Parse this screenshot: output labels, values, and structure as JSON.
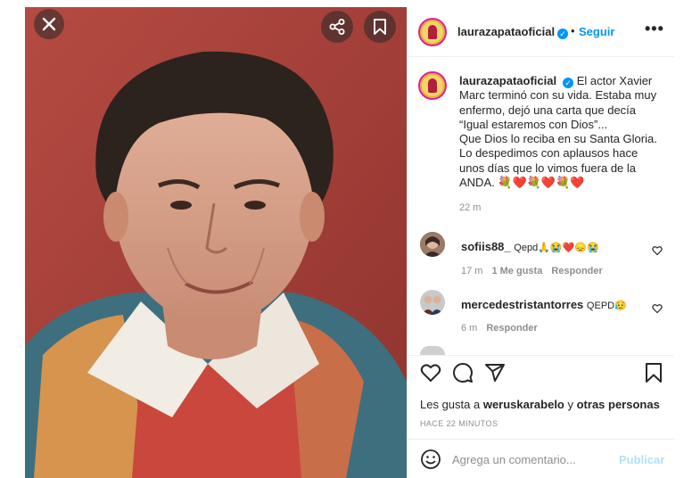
{
  "post": {
    "username": "laurazapataoficial",
    "follow_label": "Seguir",
    "separator": "•",
    "more_label": "•••",
    "verified_glyph": "✓",
    "caption_lines": [
      "El actor Xavier",
      "Marc terminó con su vida. Estaba muy",
      "enfermo, dejó una carta que decía",
      "“Igual estaremos con Dios”...",
      "Que Dios lo reciba en su Santa Gloria.",
      "Lo despedimos con aplausos hace",
      "unos días que lo vimos fuera de la",
      "ANDA. 💐❤️💐❤️💐❤️"
    ],
    "caption_time": "22 m"
  },
  "comments": [
    {
      "username": "sofiis88_",
      "text": "Qepd🙏😭❤️😞😭",
      "time": "17 m",
      "likes": "1 Me gusta",
      "reply": "Responder"
    },
    {
      "username": "mercedestristantorres",
      "text": "QEPD😥",
      "time": "6 m",
      "reply": "Responder"
    }
  ],
  "footer": {
    "likes_prefix": "Les gusta a ",
    "likes_user": "weruskarabelo",
    "likes_middle": " y ",
    "likes_others": "otras personas",
    "post_time": "HACE 22 MINUTOS",
    "comment_placeholder": "Agrega un comentario...",
    "publish_label": "Publicar"
  },
  "icons": {
    "close": "close-icon",
    "share": "share-icon",
    "save": "bookmark-icon",
    "like": "heart-icon",
    "comment": "comment-icon",
    "send": "send-icon",
    "emoji": "emoji-icon"
  },
  "colors": {
    "accent_blue": "#0095f6",
    "publish_disabled": "#b2dffc",
    "muted_text": "#8e8e8e",
    "photo_background": "#a3403a"
  }
}
